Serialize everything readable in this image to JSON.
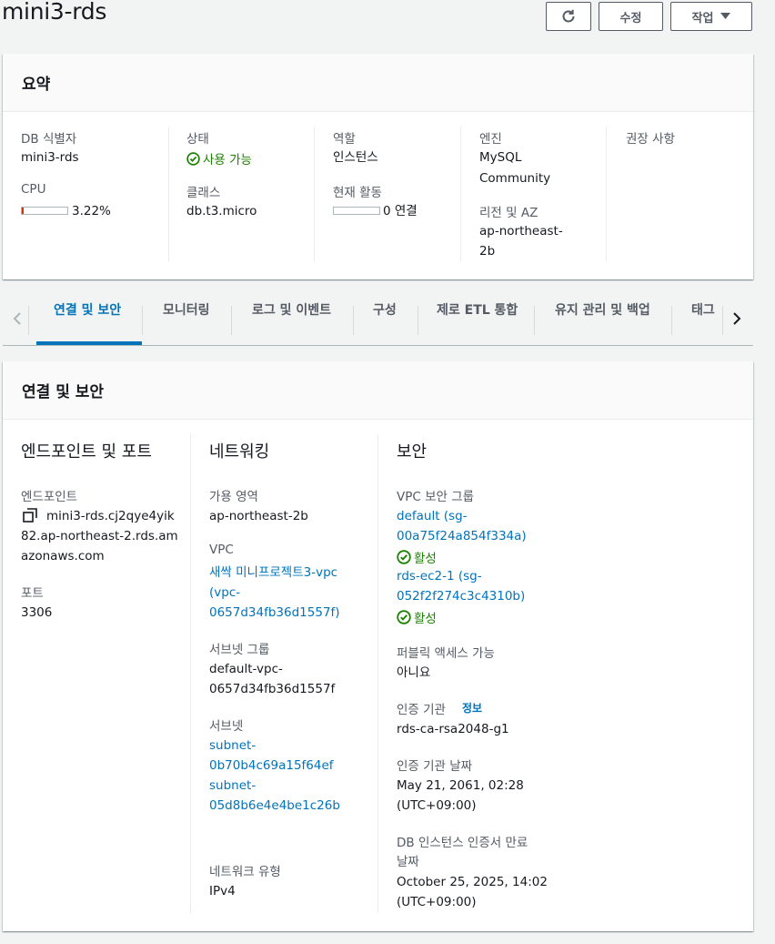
{
  "header": {
    "title": "mini3-rds",
    "refresh_icon": "refresh-icon",
    "modify_label": "수정",
    "actions_label": "작업"
  },
  "summary": {
    "title": "요약",
    "db_identifier_label": "DB 식별자",
    "db_identifier": "mini3-rds",
    "cpu_label": "CPU",
    "cpu_value": "3.22%",
    "cpu_fraction": 0.0322,
    "status_label": "상태",
    "status_value": "사용 가능",
    "class_label": "클래스",
    "class_value": "db.t3.micro",
    "role_label": "역할",
    "role_value": "인스턴스",
    "activity_label": "현재 활동",
    "activity_value": "0 연결",
    "engine_label": "엔진",
    "engine_line1": "MySQL",
    "engine_line2": "Community",
    "region_label": "리전 및 AZ",
    "region_line1": "ap-northeast-",
    "region_line2": "2b",
    "recommendations_label": "권장 사항"
  },
  "tabs": [
    {
      "label": "연결 및 보안",
      "selected": true
    },
    {
      "label": "모니터링"
    },
    {
      "label": "로그 및 이벤트"
    },
    {
      "label": "구성"
    },
    {
      "label": "제로 ETL 통합"
    },
    {
      "label": "유지 관리 및 백업"
    },
    {
      "label": "태그"
    }
  ],
  "connectivity": {
    "title": "연결 및 보안",
    "endpoint_col": {
      "heading": "엔드포인트 및 포트",
      "endpoint_label": "엔드포인트",
      "endpoint_line1": "mini3-rds.cj2qye4yik",
      "endpoint_line2": "82.ap-northeast-2.rds.am",
      "endpoint_line3": "azonaws.com",
      "port_label": "포트",
      "port_value": "3306"
    },
    "networking_col": {
      "heading": "네트워킹",
      "az_label": "가용 영역",
      "az_value": "ap-northeast-2b",
      "vpc_label": "VPC",
      "vpc_line1": "새싹 미니프로젝트3-vpc",
      "vpc_line2": "(vpc-",
      "vpc_line3": "0657d34fb36d1557f)",
      "subnet_group_label": "서브넷 그룹",
      "subnet_group_line1": "default-vpc-",
      "subnet_group_line2": "0657d34fb36d1557f",
      "subnets_label": "서브넷",
      "subnet1_line1": "subnet-",
      "subnet1_line2": "0b70b4c69a15f64ef",
      "subnet2_line1": "subnet-",
      "subnet2_line2": "05d8b6e4e4be1c26b",
      "network_type_label": "네트워크 유형",
      "network_type_value": "IPv4"
    },
    "security_col": {
      "heading": "보안",
      "sg_label": "VPC 보안 그룹",
      "sg1_line1": "default (sg-",
      "sg1_line2": "00a75f24a854f334a)",
      "sg1_status": "활성",
      "sg2_line1": "rds-ec2-1 (sg-",
      "sg2_line2": "052f2f274c3c4310b)",
      "sg2_status": "활성",
      "public_label": "퍼블릭 액세스 가능",
      "public_value": "아니요",
      "ca_label": "인증 기관",
      "ca_info": "정보",
      "ca_value": "rds-ca-rsa2048-g1",
      "ca_date_label": "인증 기관 날짜",
      "ca_date_line1": "May 21, 2061, 02:28",
      "ca_date_line2": "(UTC+09:00)",
      "cert_exp_label_line1": "DB 인스턴스 인증서 만료",
      "cert_exp_label_line2": "날짜",
      "cert_exp_line1": "October 25, 2025, 14:02",
      "cert_exp_line2": "(UTC+09:00)"
    }
  },
  "colors": {
    "link": "#0073bb",
    "success": "#1d8102",
    "tab_active": "#0073bb",
    "text": "#16191f",
    "label": "#545b64"
  }
}
